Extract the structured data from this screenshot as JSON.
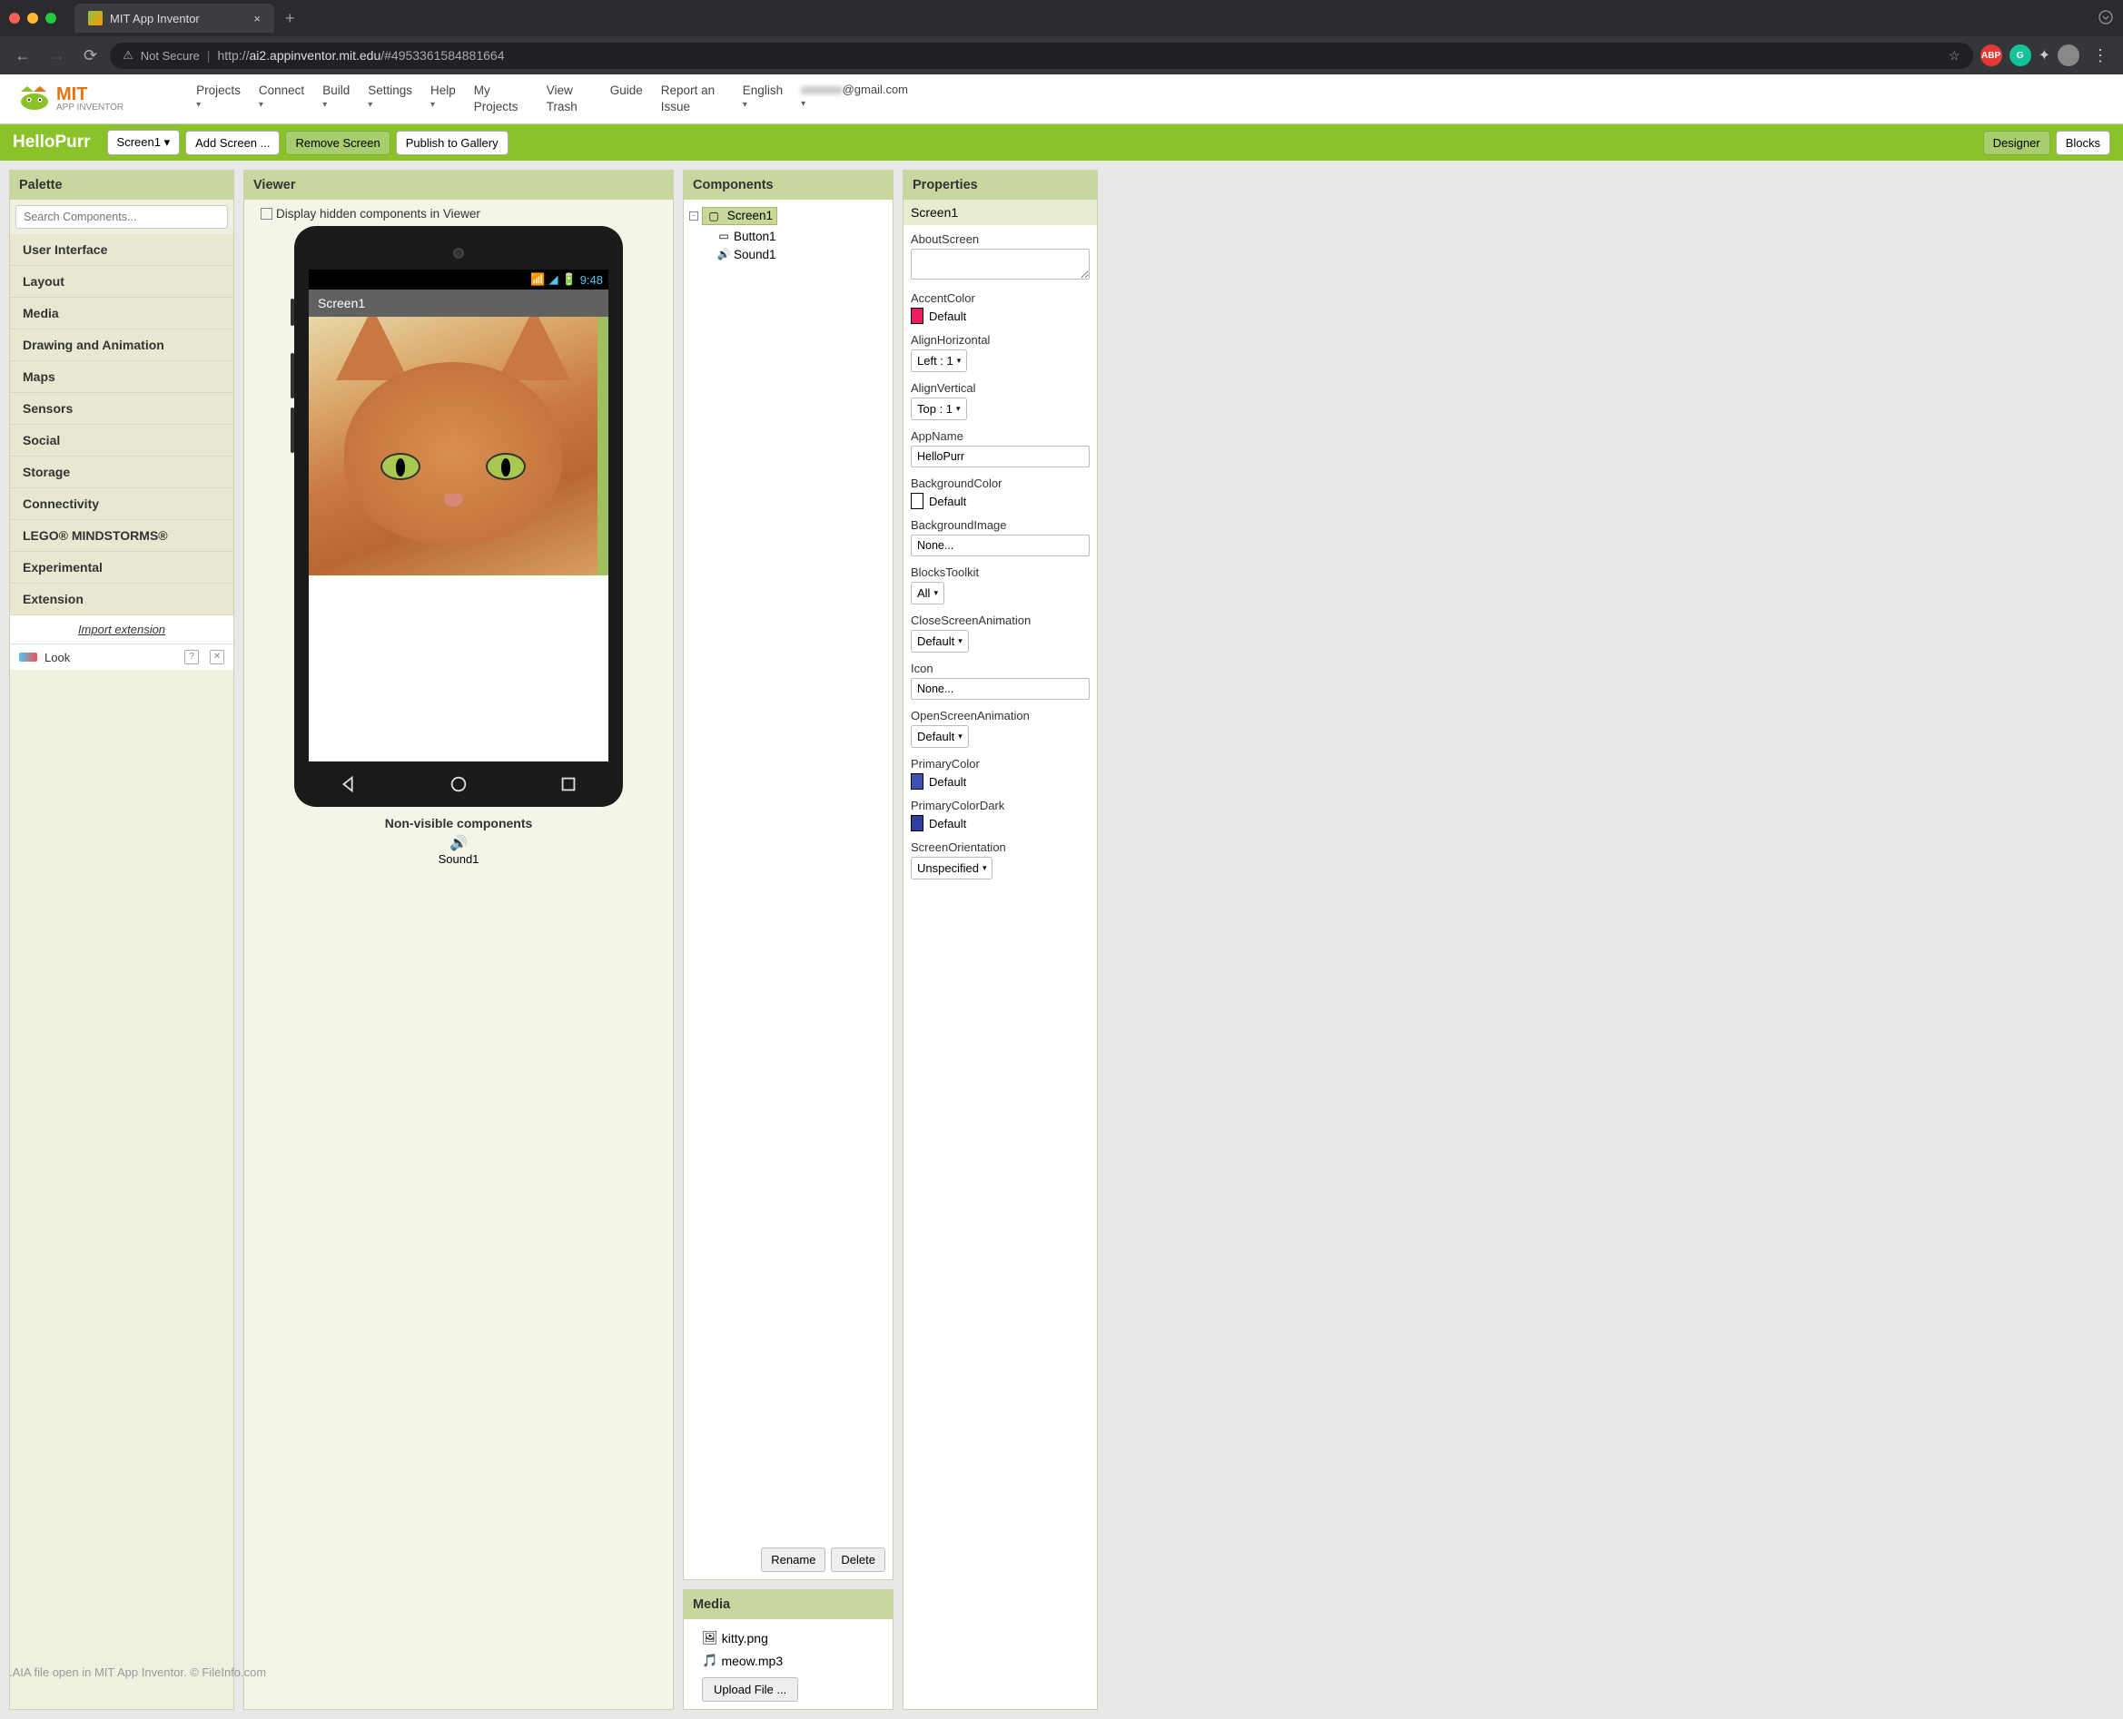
{
  "browser": {
    "tab_title": "MIT App Inventor",
    "url_insecure": "Not Secure",
    "url_prefix": "http://",
    "url_host": "ai2.appinventor.mit.edu",
    "url_path": "/#4953361584881664",
    "star": "☆",
    "abp": "ABP",
    "grammarly": "G"
  },
  "logo": {
    "mit": "MIT",
    "sub": "APP INVENTOR"
  },
  "nav": {
    "projects": "Projects",
    "connect": "Connect",
    "build": "Build",
    "settings": "Settings",
    "help": "Help",
    "my_projects": "My Projects",
    "view_trash": "View Trash",
    "guide": "Guide",
    "report": "Report an Issue",
    "english": "English",
    "email": "@gmail.com"
  },
  "greenbar": {
    "project": "HelloPurr",
    "screen_dd": "Screen1 ▾",
    "add_screen": "Add Screen ...",
    "remove_screen": "Remove Screen",
    "publish": "Publish to Gallery",
    "designer": "Designer",
    "blocks": "Blocks"
  },
  "palette": {
    "header": "Palette",
    "search_placeholder": "Search Components...",
    "cats": [
      "User Interface",
      "Layout",
      "Media",
      "Drawing and Animation",
      "Maps",
      "Sensors",
      "Social",
      "Storage",
      "Connectivity",
      "LEGO® MINDSTORMS®",
      "Experimental",
      "Extension"
    ],
    "import_ext": "Import extension",
    "look": "Look"
  },
  "viewer": {
    "header": "Viewer",
    "hidden_label": "Display hidden components in Viewer",
    "status_time": "9:48",
    "app_bar": "Screen1",
    "nonvis_header": "Non-visible components",
    "nonvis_item": "Sound1"
  },
  "components": {
    "header": "Components",
    "tree": {
      "screen": "Screen1",
      "button": "Button1",
      "sound": "Sound1"
    },
    "rename": "Rename",
    "delete": "Delete"
  },
  "media": {
    "header": "Media",
    "items": [
      "kitty.png",
      "meow.mp3"
    ],
    "upload": "Upload File ..."
  },
  "properties": {
    "header": "Properties",
    "subject": "Screen1",
    "about": {
      "label": "AboutScreen"
    },
    "accent": {
      "label": "AccentColor",
      "value": "Default"
    },
    "alignh": {
      "label": "AlignHorizontal",
      "value": "Left : 1"
    },
    "alignv": {
      "label": "AlignVertical",
      "value": "Top : 1"
    },
    "appname": {
      "label": "AppName",
      "value": "HelloPurr"
    },
    "bgcolor": {
      "label": "BackgroundColor",
      "value": "Default"
    },
    "bgimg": {
      "label": "BackgroundImage",
      "value": "None..."
    },
    "blocks": {
      "label": "BlocksToolkit",
      "value": "All"
    },
    "closeanim": {
      "label": "CloseScreenAnimation",
      "value": "Default"
    },
    "icon": {
      "label": "Icon",
      "value": "None..."
    },
    "openanim": {
      "label": "OpenScreenAnimation",
      "value": "Default"
    },
    "primcolor": {
      "label": "PrimaryColor",
      "value": "Default"
    },
    "primdark": {
      "label": "PrimaryColorDark",
      "value": "Default"
    },
    "orient": {
      "label": "ScreenOrientation",
      "value": "Unspecified"
    }
  },
  "footer": ".AIA file open in MIT App Inventor. © FileInfo.com"
}
